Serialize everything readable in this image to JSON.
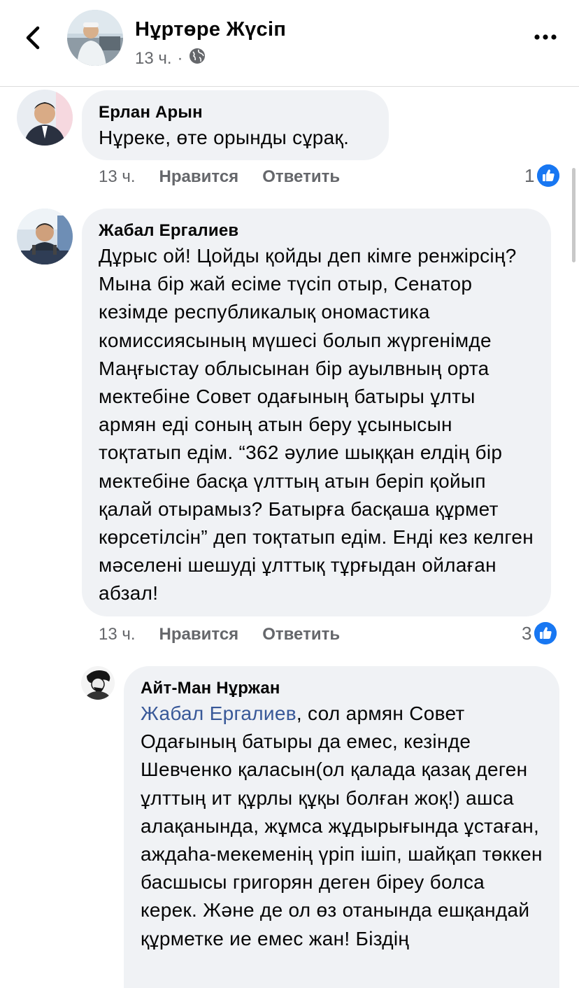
{
  "header": {
    "author_name": "Нұртөре Жүсіп",
    "time": "13 ч.",
    "separator": "·",
    "privacy_icon": "globe-icon",
    "back_icon": "back-chevron-icon",
    "more_icon": "more-dots-icon"
  },
  "comments": [
    {
      "author": "Ерлан Арын",
      "text": "Нұреке, өте орынды сұрақ.",
      "time": "13 ч.",
      "like_label": "Нравится",
      "reply_label": "Ответить",
      "like_count": "1"
    },
    {
      "author": "Жабал Ергалиев",
      "text": "Дұрыс ой! Цойды қойды деп кімге ренжірсің? Мына бір жай есіме түсіп отыр, Сенатор кезімде республикалық ономастика комиссиясының мүшесі болып жүргенімде Маңғыстау облысынан бір ауылвның орта мектебіне Совет одағының батыры ұлты армян еді соның атын беру ұсынысын тоқтатып едім. “362 әулие шыққан елдің бір мектебіне басқа үлттың атын беріп қойып қалай отырамыз? Батырға басқаша құрмет көрсетілсін” деп тоқтатып едім. Енді кез келген мәселені шешуді ұлттық тұрғыдан ойлаған абзал!",
      "time": "13 ч.",
      "like_label": "Нравится",
      "reply_label": "Ответить",
      "like_count": "3"
    },
    {
      "author": "Айт-Ман Нұржан",
      "mention": "Жабал Ергалиев",
      "text": ", сол армян Совет Одағының батыры да емес, кезінде Шевченко қаласын(ол қалада қазақ деген ұлттың ит құрлы құқы болған жоқ!) ашса алақанында, жұмса жұдырығында ұстаған, аждаһа-мекеменің үріп ішіп, шайқап төккен басшысы григорян деген біреу болса керек. Және де ол өз отанында ешқандай құрметке ие емес жан! Біздің"
    }
  ],
  "colors": {
    "bubble": "#f0f2f5",
    "secondary_text": "#65676b",
    "like_blue": "#1877f2",
    "mention": "#385898"
  }
}
